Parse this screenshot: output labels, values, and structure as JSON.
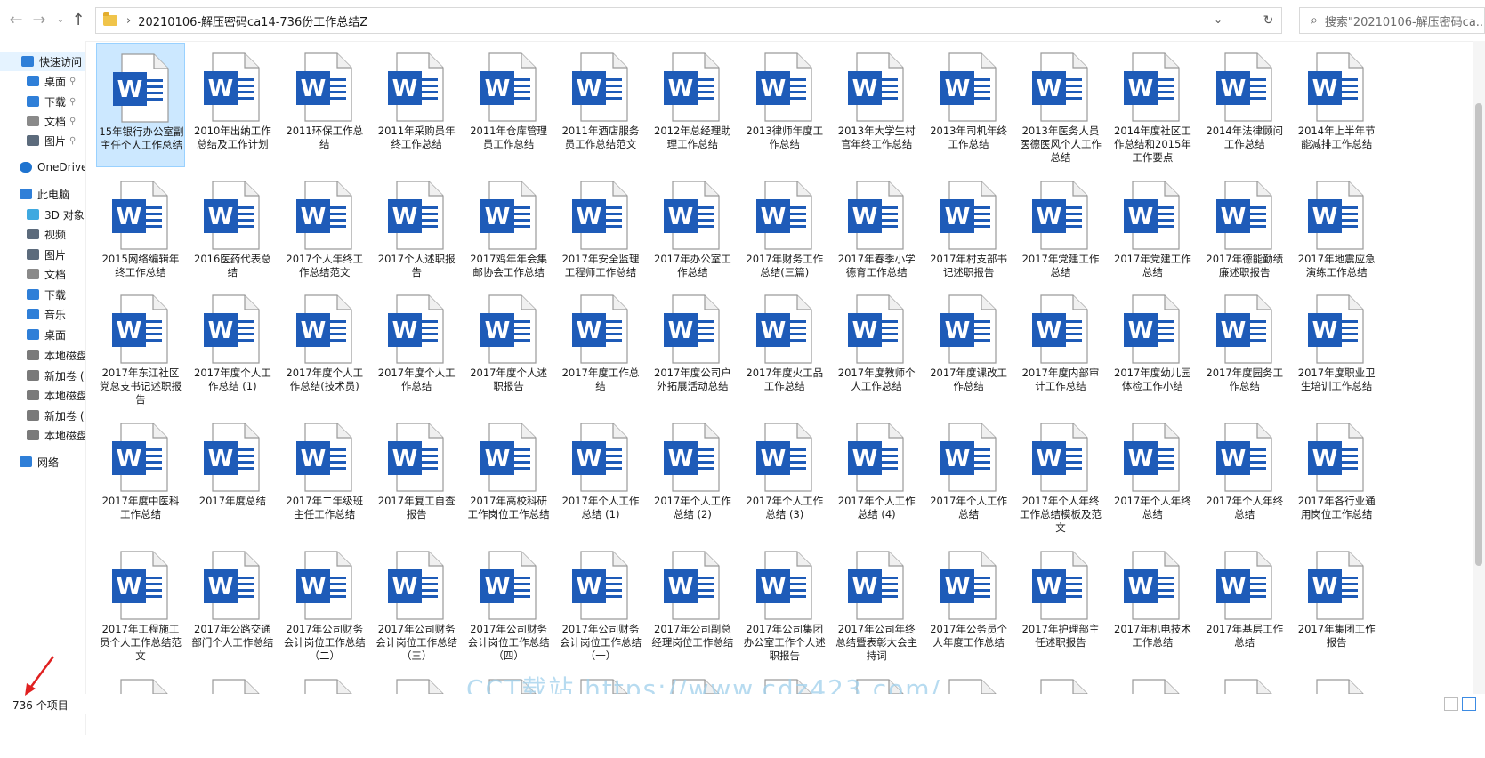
{
  "address": {
    "path": "20210106-解压密码ca14-736份工作总结Z",
    "search_placeholder": "搜索\"20210106-解压密码ca..."
  },
  "sidebar": {
    "items": [
      {
        "label": "快速访问",
        "icon": "star-icon",
        "pinned": false,
        "selected": true
      },
      {
        "label": "桌面",
        "icon": "desktop-icon",
        "pinned": true
      },
      {
        "label": "下载",
        "icon": "download-icon",
        "pinned": true
      },
      {
        "label": "文档",
        "icon": "document-icon",
        "pinned": true
      },
      {
        "label": "图片",
        "icon": "picture-icon",
        "pinned": true
      },
      {
        "label": "OneDrive",
        "icon": "cloud-icon"
      },
      {
        "label": "此电脑",
        "icon": "computer-icon"
      },
      {
        "label": "3D 对象",
        "icon": "cube-icon"
      },
      {
        "label": "视频",
        "icon": "video-icon"
      },
      {
        "label": "图片",
        "icon": "picture-icon"
      },
      {
        "label": "文档",
        "icon": "document-icon"
      },
      {
        "label": "下载",
        "icon": "download-icon"
      },
      {
        "label": "音乐",
        "icon": "music-icon"
      },
      {
        "label": "桌面",
        "icon": "desktop-icon"
      },
      {
        "label": "本地磁盘",
        "icon": "drive-icon"
      },
      {
        "label": "新加卷 (",
        "icon": "drive-icon"
      },
      {
        "label": "本地磁盘",
        "icon": "drive-icon"
      },
      {
        "label": "新加卷 (",
        "icon": "drive-icon"
      },
      {
        "label": "本地磁盘",
        "icon": "drive-icon"
      },
      {
        "label": "网络",
        "icon": "network-icon"
      }
    ]
  },
  "files": [
    "15年银行办公室副主任个人工作总结",
    "2010年出纳工作总结及工作计划",
    "2011环保工作总结",
    "2011年采购员年终工作总结",
    "2011年仓库管理员工作总结",
    "2011年酒店服务员工作总结范文",
    "2012年总经理助理工作总结",
    "2013律师年度工作总结",
    "2013年大学生村官年终工作总结",
    "2013年司机年终工作总结",
    "2013年医务人员医德医风个人工作总结",
    "2014年度社区工作总结和2015年工作要点",
    "2014年法律顾问工作总结",
    "2014年上半年节能减排工作总结",
    "2015网络编辑年终工作总结",
    "2016医药代表总结",
    "2017个人年终工作总结范文",
    "2017个人述职报告",
    "2017鸡年年会集邮协会工作总结",
    "2017年安全监理工程师工作总结",
    "2017年办公室工作总结",
    "2017年财务工作总结(三篇)",
    "2017年春季小学德育工作总结",
    "2017年村支部书记述职报告",
    "2017年党建工作总结",
    "2017年党建工作总结",
    "2017年德能勤绩廉述职报告",
    "2017年地震应急演练工作总结",
    "2017年东江社区党总支书记述职报告",
    "2017年度个人工作总结 (1)",
    "2017年度个人工作总结(技术员)",
    "2017年度个人工作总结",
    "2017年度个人述职报告",
    "2017年度工作总结",
    "2017年度公司户外拓展活动总结",
    "2017年度火工品工作总结",
    "2017年度教师个人工作总结",
    "2017年度课改工作总结",
    "2017年度内部审计工作总结",
    "2017年度幼儿园体检工作小结",
    "2017年度园务工作总结",
    "2017年度职业卫生培训工作总结",
    "2017年度中医科工作总结",
    "2017年度总结",
    "2017年二年级班主任工作总结",
    "2017年复工自查报告",
    "2017年高校科研工作岗位工作总结",
    "2017年个人工作总结 (1)",
    "2017年个人工作总结 (2)",
    "2017年个人工作总结 (3)",
    "2017年个人工作总结 (4)",
    "2017年个人工作总结",
    "2017年个人年终工作总结模板及范文",
    "2017年个人年终总结",
    "2017年个人年终总结",
    "2017年各行业通用岗位工作总结",
    "2017年工程施工员个人工作总结范文",
    "2017年公路交通部门个人工作总结",
    "2017年公司财务会计岗位工作总结（二）",
    "2017年公司财务会计岗位工作总结（三）",
    "2017年公司财务会计岗位工作总结（四）",
    "2017年公司财务会计岗位工作总结（一）",
    "2017年公司副总经理岗位工作总结",
    "2017年公司集团办公室工作个人述职报告",
    "2017年公司年终总结暨表彰大会主持词",
    "2017年公务员个人年度工作总结",
    "2017年护理部主任述职报告",
    "2017年机电技术工作总结",
    "2017年基层工作总结",
    "2017年集团工作报告"
  ],
  "status": {
    "count": "736 个项目"
  },
  "watermark": "CCT载站 https://www.cdz423.com/",
  "colors": {
    "word_blue": "#1e5bb8",
    "selection": "#cce8ff"
  }
}
